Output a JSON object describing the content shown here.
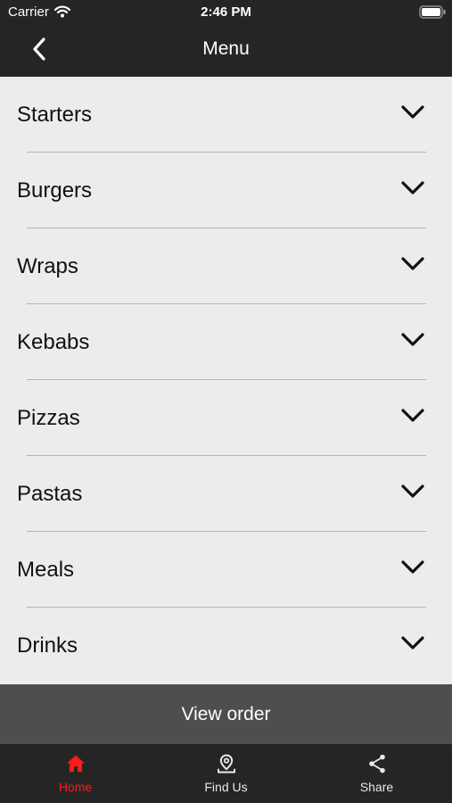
{
  "status_bar": {
    "carrier": "Carrier",
    "time": "2:46 PM",
    "wifi_icon": "wifi-icon",
    "battery_icon": "battery-icon"
  },
  "nav_bar": {
    "title": "Menu",
    "back_icon": "chevron-left-icon"
  },
  "menu": {
    "items": [
      {
        "label": "Starters",
        "icon": "chevron-down-icon"
      },
      {
        "label": "Burgers",
        "icon": "chevron-down-icon"
      },
      {
        "label": "Wraps",
        "icon": "chevron-down-icon"
      },
      {
        "label": "Kebabs",
        "icon": "chevron-down-icon"
      },
      {
        "label": "Pizzas",
        "icon": "chevron-down-icon"
      },
      {
        "label": "Pastas",
        "icon": "chevron-down-icon"
      },
      {
        "label": "Meals",
        "icon": "chevron-down-icon"
      },
      {
        "label": "Drinks",
        "icon": "chevron-down-icon"
      }
    ]
  },
  "view_order": {
    "label": "View order"
  },
  "tab_bar": {
    "tabs": [
      {
        "label": "Home",
        "icon": "home-icon",
        "active": true
      },
      {
        "label": "Find Us",
        "icon": "map-pin-icon",
        "active": false
      },
      {
        "label": "Share",
        "icon": "share-icon",
        "active": false
      }
    ]
  },
  "colors": {
    "bar_background": "#252525",
    "list_background": "#ececec",
    "divider": "#b5b5b5",
    "view_order_background": "#4e4e4e",
    "active_tab": "#ff1a1a",
    "inactive_tab": "#e8e8e8"
  }
}
